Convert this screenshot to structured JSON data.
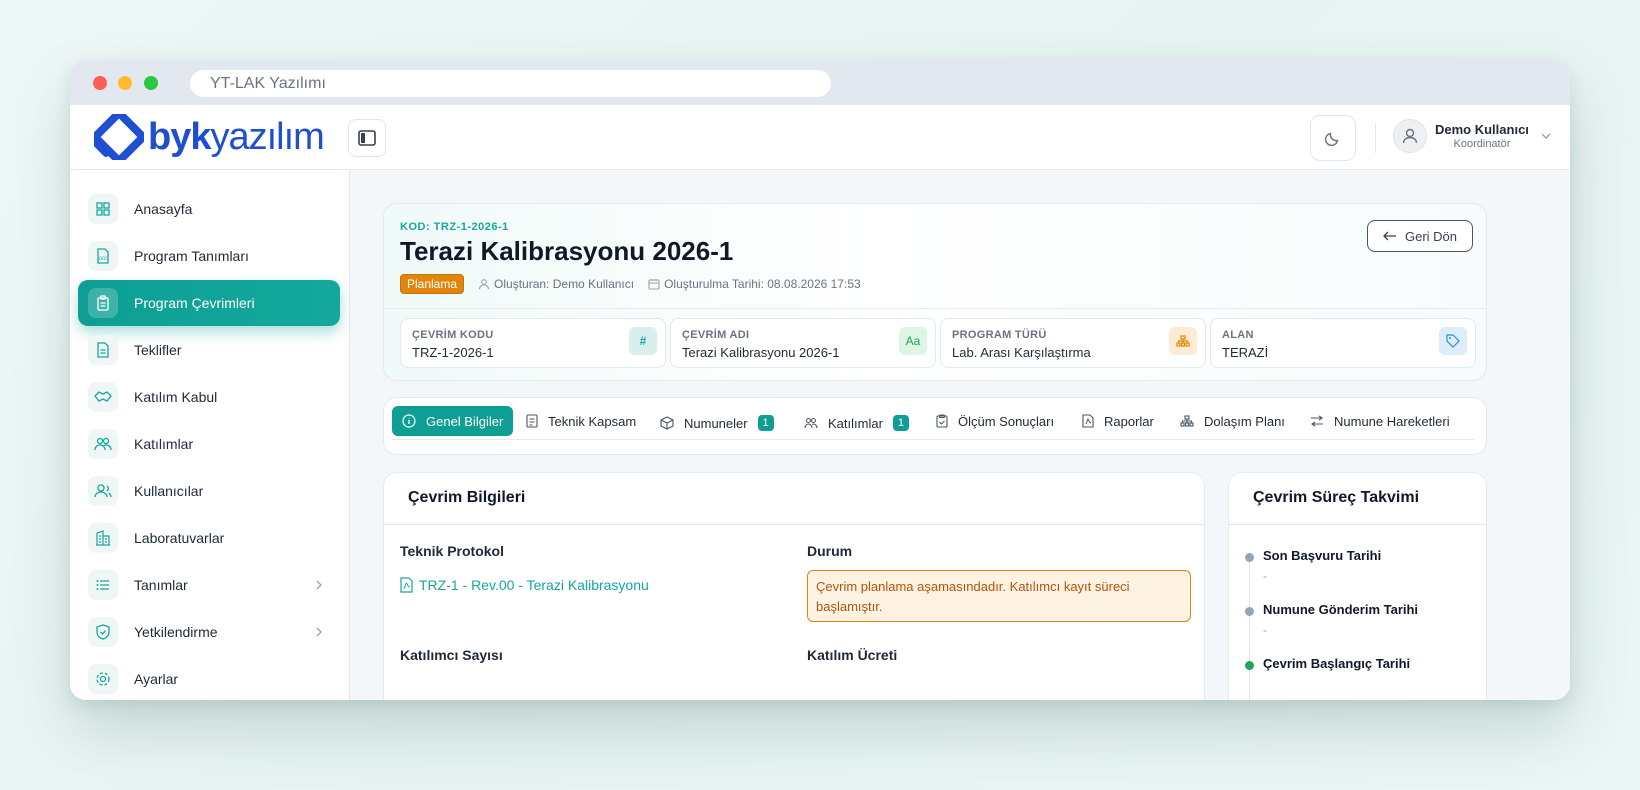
{
  "window": {
    "url_title": "YT-LAK Yazılımı"
  },
  "brand": {
    "bold": "byk",
    "light": "yazılım"
  },
  "user": {
    "name": "Demo Kullanıcı",
    "role": "Koordinatör"
  },
  "colors": {
    "accent": "#0e9e94",
    "brand": "#1e4fd0",
    "warning": "#e0860f"
  },
  "sidebar": {
    "items": [
      {
        "label": "Anasayfa",
        "icon": "grid-icon"
      },
      {
        "label": "Program Tanımları",
        "icon": "doc-icon"
      },
      {
        "label": "Program Çevrimleri",
        "icon": "clipboard-icon",
        "active": true
      },
      {
        "label": "Teklifler",
        "icon": "file-icon"
      },
      {
        "label": "Katılım Kabul",
        "icon": "handshake-icon"
      },
      {
        "label": "Katılımlar",
        "icon": "users-icon"
      },
      {
        "label": "Kullanıcılar",
        "icon": "user-group-icon"
      },
      {
        "label": "Laboratuvarlar",
        "icon": "building-icon"
      },
      {
        "label": "Tanımlar",
        "icon": "list-icon",
        "has_children": true
      },
      {
        "label": "Yetkilendirme",
        "icon": "shield-icon",
        "has_children": true
      },
      {
        "label": "Ayarlar",
        "icon": "gear-icon"
      }
    ]
  },
  "program": {
    "code_label": "KOD: TRZ-1-2026-1",
    "title": "Terazi Kalibrasyonu 2026-1",
    "status": "Planlama",
    "created_by": "Oluşturan: Demo Kullanıcı",
    "created_at": "Oluşturulma Tarihi: 08.08.2026 17:53",
    "back_label": "Geri Dön"
  },
  "info_boxes": [
    {
      "label": "ÇEVRİM KODU",
      "value": "TRZ-1-2026-1",
      "icon_text": "#"
    },
    {
      "label": "ÇEVRİM ADI",
      "value": "Terazi Kalibrasyonu 2026-1",
      "icon_text": "Aa"
    },
    {
      "label": "PROGRAM TÜRÜ",
      "value": "Lab. Arası Karşılaştırma",
      "icon_text": ""
    },
    {
      "label": "ALAN",
      "value": "TERAZİ",
      "icon_text": ""
    }
  ],
  "tabs": [
    {
      "label": "Genel Bilgiler"
    },
    {
      "label": "Teknik Kapsam"
    },
    {
      "label": "Numuneler",
      "count": "1"
    },
    {
      "label": "Katılımlar",
      "count": "1"
    },
    {
      "label": "Ölçüm Sonuçları"
    },
    {
      "label": "Raporlar"
    },
    {
      "label": "Dolaşım Planı"
    },
    {
      "label": "Numune Hareketleri"
    }
  ],
  "bilgi": {
    "title": "Çevrim Bilgileri",
    "protocol_label": "Teknik Protokol",
    "protocol_link": "TRZ-1 - Rev.00 - Terazi Kalibrasyonu",
    "status_label": "Durum",
    "status_text": "Çevrim planlama aşamasındadır. Katılımcı kayıt süreci başlamıştır.",
    "participant_count_label": "Katılımcı Sayısı",
    "fee_label": "Katılım Ücreti"
  },
  "takvim": {
    "title": "Çevrim Süreç Takvimi",
    "items": [
      {
        "title": "Son Başvuru Tarihi",
        "value": "-"
      },
      {
        "title": "Numune Gönderim Tarihi",
        "value": "-"
      },
      {
        "title": "Çevrim Başlangıç Tarihi",
        "value": ""
      }
    ]
  }
}
